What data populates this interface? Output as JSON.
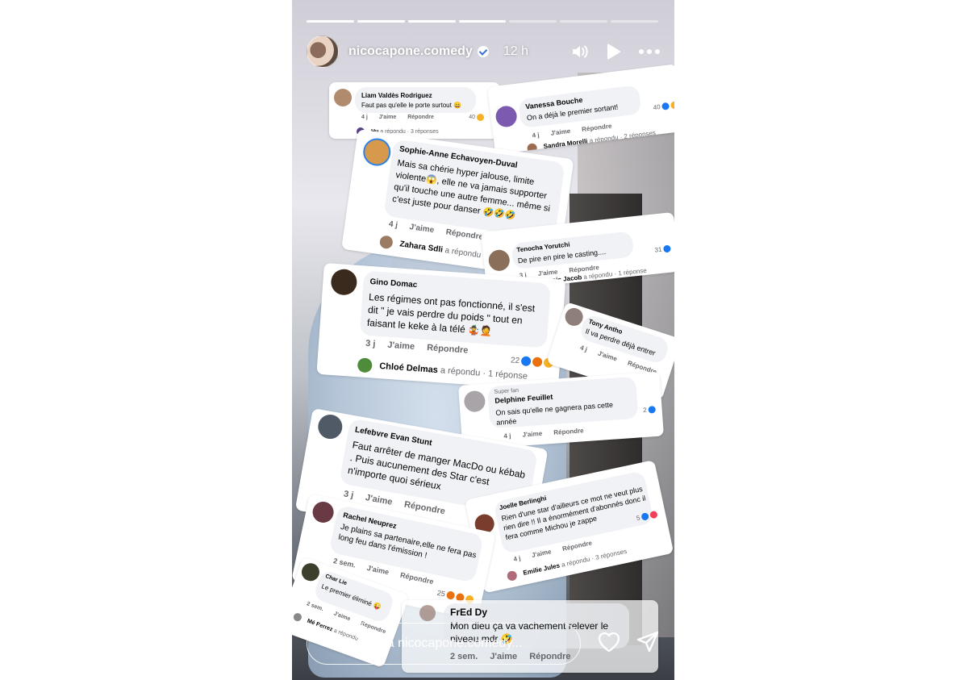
{
  "story": {
    "username": "nicocapone.comedy",
    "time": "12 h",
    "progress_done": 4,
    "progress_total": 7
  },
  "comments": [
    {
      "name": "Liam Valdès Rodriguez",
      "text": "Faut pas qu'elle le porte surtout 😄",
      "time": "4 j",
      "like": "J'aime",
      "reply": "Répondre",
      "count": "40",
      "reply_line_user": "Hu",
      "reply_line_action": "a répondu",
      "reply_line_count": "· 3 réponses"
    },
    {
      "name": "Vanessa Bouche",
      "text": "On a déjà le premier sortant!",
      "time": "4 j",
      "like": "J'aime",
      "reply": "Répondre",
      "count": "40",
      "reply_line_user": "Sandra Morelli",
      "reply_line_action": "a répondu",
      "reply_line_count": "· 2 réponses"
    },
    {
      "name": "Sophie-Anne Echavoyen-Duval",
      "text": "Mais sa chérie hyper jalouse, limite violente😱, elle ne va jamais supporter qu'il touche une autre femme... même si c'est juste pour danser 🤣🤣🤣",
      "time": "4 j",
      "like": "J'aime",
      "reply": "Répondre",
      "reply_line_user": "Zahara Sdli",
      "reply_line_action": "a répondu",
      "reply_line_count": "· 1"
    },
    {
      "name": "Tenocha Yorutchi",
      "text": "De pire en pire le casting....",
      "time": "3 j",
      "like": "J'aime",
      "reply": "Répondre",
      "count": "31",
      "reply_line_user": "François Jacob",
      "reply_line_action": "a répondu",
      "reply_line_count": "· 1 réponse"
    },
    {
      "name": "Gino Domac",
      "text": "Les régimes ont pas fonctionné, il s'est dit \" je vais perdre du poids \" tout en faisant le keke à la télé 🤹🤦",
      "time": "3 j",
      "like": "J'aime",
      "reply": "Répondre",
      "count": "22",
      "reply_line_user": "Chloé Delmas",
      "reply_line_action": "a répondu",
      "reply_line_count": "· 1 réponse"
    },
    {
      "name": "Tony Antho",
      "text": "Il va perdre déjà entrer",
      "time": "4 j",
      "like": "J'aime",
      "reply": "Répondre"
    },
    {
      "badge": "Super fan",
      "name": "Delphine Feuillet",
      "text": "On sais qu'elle ne gagnera pas cette année",
      "time": "4 j",
      "like": "J'aime",
      "reply": "Répondre",
      "count": "2"
    },
    {
      "name": "Lefebvre Evan Stunt",
      "text": "Faut arrêter de manger MacDo ou kébab . Puis aucunement des Star c'est n'importe quoi sérieux",
      "time": "3 j",
      "like": "J'aime",
      "reply": "Répondre"
    },
    {
      "name": "Joelle Berlinghi",
      "text": "Rien d'une star d'ailleurs ce mot ne veut plus rien dire !! Il a énormément d'abonnés donc il fera comme Michou je zappe",
      "time": "4 j",
      "like": "J'aime",
      "reply": "Répondre",
      "count": "5",
      "reply_line_user": "Emilie Jules",
      "reply_line_action": "a répondu",
      "reply_line_count": "· 3 réponses"
    },
    {
      "name": "Rachel Neuprez",
      "text": "Je plains sa partenaire,elle ne fera pas long feu dans l'émission !",
      "time": "2 sem.",
      "like": "J'aime",
      "reply": "Répondre",
      "count": "25"
    },
    {
      "name": "Char Lie",
      "text": "Le premier éliminé 😜",
      "time": "2 sem.",
      "like": "J'aime",
      "reply": "Répondre",
      "reply_line_user": "Mé Perrez",
      "reply_line_action": "a répondu",
      "reply_line_count": ""
    },
    {
      "name": "FrEd Dy",
      "text": "Mon dieu ça va vachement relever le niveau mdr 🤣",
      "time": "2 sem.",
      "like": "J'aime",
      "reply": "Répondre"
    }
  ],
  "reply_bar": {
    "placeholder": "Répondre à nicocapone.comedy..."
  },
  "icons": [
    "speaker-icon",
    "play-icon",
    "more-icon",
    "heart-icon",
    "send-icon",
    "verified-badge-icon"
  ]
}
